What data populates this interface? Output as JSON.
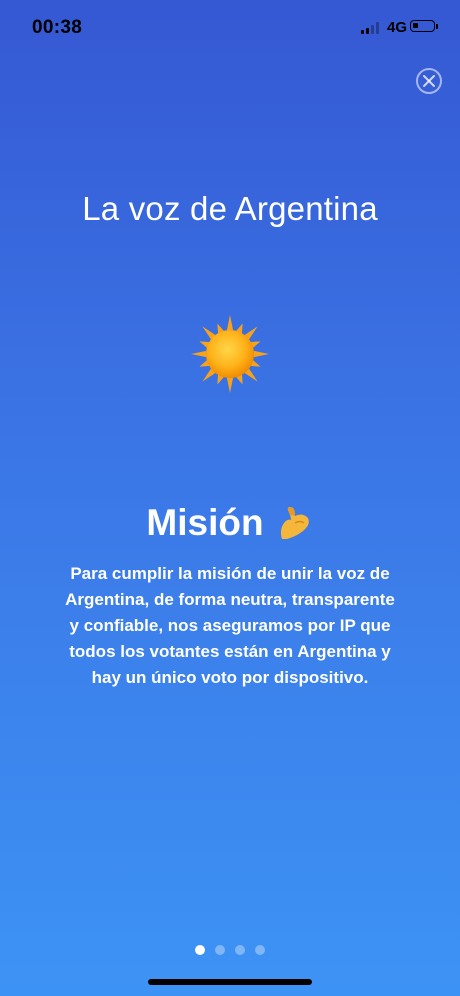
{
  "status_bar": {
    "time": "00:38",
    "network": "4G"
  },
  "onboarding": {
    "title": "La voz de Argentina",
    "hero_icon": "sun-emoji",
    "heading": "Misión",
    "heading_icon": "flexed-biceps-emoji",
    "body": "Para cumplir la misión de unir la voz de Argentina, de forma neutra, transparente y confiable, nos aseguramos por IP que todos los votantes están en Argentina y hay un único voto por dispositivo.",
    "pager": {
      "total": 4,
      "current": 1
    }
  },
  "colors": {
    "gradient_top": "#3558d3",
    "gradient_bottom": "#3d93f5"
  }
}
